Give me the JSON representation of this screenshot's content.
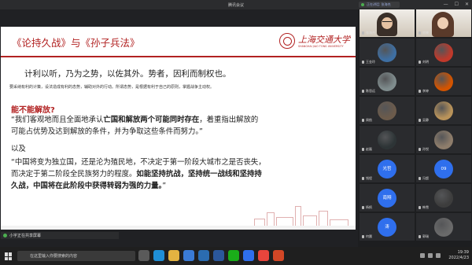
{
  "window": {
    "title": "腾讯会议",
    "speaker_label": "正在讲话: 张海杰",
    "controls": [
      "—",
      "☐",
      "✕"
    ]
  },
  "slide": {
    "title": "《论持久战》与《孙子兵法》",
    "logo": {
      "cn": "上海交通大学",
      "en": "SHANGHAI JIAO TONG UNIVERSITY"
    },
    "quote_big": "计利以听，乃为之势，以佐其外。势者，因利而制权也。",
    "quote_small": "要采纳有利的计策，设法造成有利的态势，辅助对外的行动。所谓态势，是根据有利于自己的原则，掌握战争主动权。",
    "heading": "能不能解放?",
    "p1_l1a": "“我们客观地而且全面地承认",
    "p1_l1b": "亡国和解放两个可能同时存在",
    "p1_l1c": "，着重指出解放的",
    "p1_l2": "可能占优势及达到解放的条件，并为争取这些条件而努力。”",
    "yiji": "以及",
    "p2_l1": "“中国将变为独立国，还是沦为殖民地，不决定于第一阶段大城市之是否丧失，",
    "p2_l2a": "而决定于第二阶段全民族努力的程度。",
    "p2_l2b": "如能坚持抗战，坚持统一战线和坚持持",
    "p2_l3a": "久战，中国将在此阶段中获得转弱为强的力量。",
    "p2_l3b": "”"
  },
  "share_status": "小宇正在共享屏幕",
  "participants": [
    {
      "name": "张海杰",
      "type": "video",
      "color": "#cfc6b8"
    },
    {
      "name": "房晓",
      "type": "video",
      "color": "#d6cfc4"
    },
    {
      "name": "王金玲",
      "type": "avatar",
      "color": "#3e6fa3"
    },
    {
      "name": "刘明",
      "type": "avatar",
      "color": "#c0392b"
    },
    {
      "name": "陈思远",
      "type": "avatar",
      "color": "#7f8c8d"
    },
    {
      "name": "李婷",
      "type": "avatar",
      "color": "#d35400"
    },
    {
      "name": "周航",
      "type": "avatar",
      "color": "#6c5b4b"
    },
    {
      "name": "吴静",
      "type": "avatar",
      "color": "#b9935a"
    },
    {
      "name": "赵磊",
      "type": "avatar",
      "color": "#2d3436"
    },
    {
      "name": "孙悦",
      "type": "avatar",
      "color": "#8e7d6b"
    },
    {
      "name": "钱程",
      "type": "bubble",
      "text": "光哲",
      "color": "#2f6fed"
    },
    {
      "name": "冯超",
      "type": "bubble",
      "text": "09",
      "color": "#2f6fed"
    },
    {
      "name": "杨帆",
      "type": "bubble",
      "text": "南翔",
      "color": "#2f6fed"
    },
    {
      "name": "韩雪",
      "type": "avatar",
      "color": "#3d3d3d"
    },
    {
      "name": "何晨",
      "type": "bubble",
      "text": "涛",
      "color": "#2f6fed"
    },
    {
      "name": "郭瑞",
      "type": "avatar",
      "color": "#6a6a6a"
    }
  ],
  "taskbar": {
    "search_placeholder": "在这里输入你要搜索的内容",
    "time": "19:39",
    "date": "2022/4/23",
    "apps": [
      {
        "name": "task-view",
        "color": "#5a5a5a"
      },
      {
        "name": "edge",
        "color": "#1f8fd6"
      },
      {
        "name": "explorer",
        "color": "#e3b341"
      },
      {
        "name": "store",
        "color": "#3a7bd5"
      },
      {
        "name": "mail",
        "color": "#2b6cb0"
      },
      {
        "name": "word",
        "color": "#2b579a"
      },
      {
        "name": "wechat",
        "color": "#1aad19"
      },
      {
        "name": "meeting",
        "color": "#2f6fed"
      },
      {
        "name": "chrome",
        "color": "#e8453c"
      },
      {
        "name": "powerpoint",
        "color": "#d24726"
      }
    ]
  }
}
